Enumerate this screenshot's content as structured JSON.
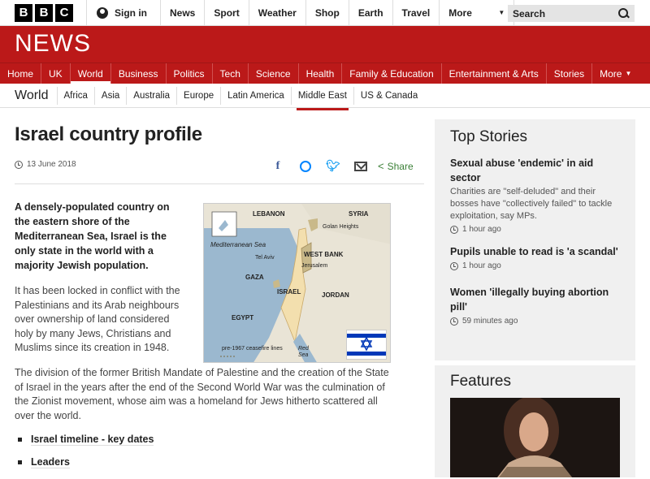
{
  "topbar": {
    "logo_letters": [
      "B",
      "B",
      "C"
    ],
    "signin": "Sign in",
    "nav": [
      "News",
      "Sport",
      "Weather",
      "Shop",
      "Earth",
      "Travel"
    ],
    "more": "More",
    "search_placeholder": "Search"
  },
  "banner": {
    "title": "NEWS"
  },
  "mainnav": [
    "Home",
    "UK",
    "World",
    "Business",
    "Politics",
    "Tech",
    "Science",
    "Health",
    "Family & Education",
    "Entertainment & Arts",
    "Stories",
    "More"
  ],
  "subnav": {
    "section": "World",
    "items": [
      "Africa",
      "Asia",
      "Australia",
      "Europe",
      "Latin America",
      "Middle East",
      "US & Canada"
    ]
  },
  "article": {
    "title": "Israel country profile",
    "date": "13 June 2018",
    "share_label": "Share",
    "intro": "A densely-populated country on the eastern shore of the Mediterranean Sea, Israel is the only state in the world with a majority Jewish population.",
    "para1": "It has been locked in conflict with the Palestinians and its Arab neighbours over ownership of land considered holy by many Jews, Christians and Muslims since its creation in 1948.",
    "para2": "The division of the former British Mandate of Palestine and the creation of the State of Israel in the years after the end of the Second World War was the culmination of the Zionist movement, whose aim was a homeland for Jews hitherto scattered all over the world.",
    "bullets": [
      "Israel timeline - key dates",
      "Leaders"
    ]
  },
  "map": {
    "lebanon": "LEBANON",
    "syria": "SYRIA",
    "golan": "Golan Heights",
    "med": "Mediterranean Sea",
    "telaviv": "Tel Aviv",
    "westbank": "WEST BANK",
    "jerusalem": "Jerusalem",
    "gaza": "GAZA",
    "israel": "ISRAEL",
    "jordan": "JORDAN",
    "egypt": "EGYPT",
    "legend": "pre-1967 ceasefire lines",
    "redsea": "Red Sea"
  },
  "sidebar": {
    "title": "Top Stories",
    "stories": [
      {
        "headline": "Sexual abuse 'endemic' in aid sector",
        "summary": "Charities are \"self-deluded\" and their bosses have \"collectively failed\" to tackle exploitation, say MPs.",
        "time": "1 hour ago"
      },
      {
        "headline": "Pupils unable to read is 'a scandal'",
        "time": "1 hour ago"
      },
      {
        "headline": "Women 'illegally buying abortion pill'",
        "time": "59 minutes ago"
      }
    ]
  },
  "features": {
    "title": "Features"
  },
  "colors": {
    "brand_red": "#bb1919",
    "share_green": "#3a7f36",
    "flag_blue": "#0038b8"
  }
}
